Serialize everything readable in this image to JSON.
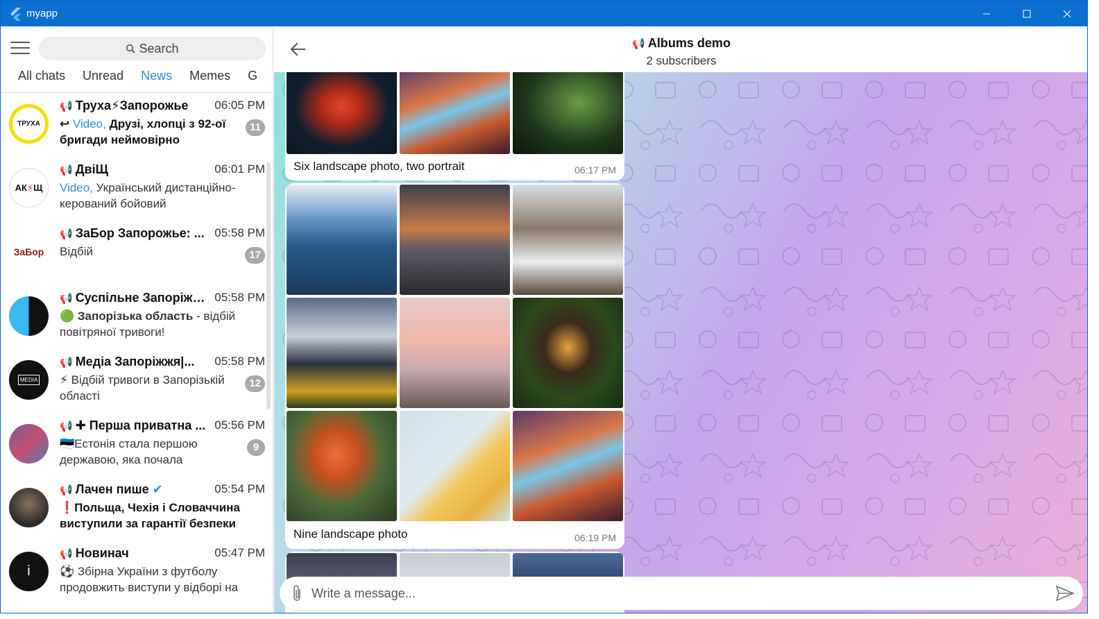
{
  "window": {
    "title": "myapp",
    "accent": "#0b6fd0"
  },
  "search": {
    "placeholder": "Search"
  },
  "tabs": [
    {
      "label": "All chats"
    },
    {
      "label": "Unread"
    },
    {
      "label": "News"
    },
    {
      "label": "Memes"
    },
    {
      "label": "G"
    }
  ],
  "chats": [
    {
      "name": "Труха⚡Запорожье",
      "time": "06:05 PM",
      "preview_prefix": "Video,",
      "preview": "Друзі, хлопці з 92-ої бригади неймовірно",
      "badge": "11"
    },
    {
      "name": "ДвіЩ",
      "time": "06:01 PM",
      "preview_prefix": "Video,",
      "preview": "Український дистанційно-керований бойовий",
      "badge": ""
    },
    {
      "name": "ЗаБор Запорожье: ...",
      "time": "05:58 PM",
      "preview_prefix": "",
      "preview": "Відбій",
      "badge": "17"
    },
    {
      "name": "Суспільне Запоріжж...",
      "time": "05:58 PM",
      "preview_prefix": "",
      "preview_bold": "Запорізька область",
      "preview": "- відбій повітряної тривоги!",
      "badge": ""
    },
    {
      "name": "Медіа Запоріжжя|...",
      "time": "05:58 PM",
      "preview_prefix": "",
      "preview": "Відбій тривоги в Запорізькій області",
      "badge": "12"
    },
    {
      "name": "Перша приватна ...",
      "time": "05:56 PM",
      "preview_prefix": "",
      "preview": "Естонія стала першою державою, яка почала",
      "badge": "9"
    },
    {
      "name": "Лачен пише",
      "time": "05:54 PM",
      "preview_prefix": "",
      "preview": "Польща, Чехія і Словаччина виступили за гарантії безпеки",
      "badge": ""
    },
    {
      "name": "Новинач",
      "time": "05:47 PM",
      "preview_prefix": "",
      "preview": "Збірна України з футболу продовжить виступи у відборі на",
      "badge": ""
    }
  ],
  "channel": {
    "title": "Albums demo",
    "subtitle": "2 subscribers"
  },
  "messages": [
    {
      "caption": "Six landscape photo, two portrait",
      "time": "06:17 PM"
    },
    {
      "caption": "Nine landscape photo",
      "time": "06:19 PM"
    }
  ],
  "composer": {
    "placeholder": "Write a message..."
  },
  "icons": {
    "menu": "hamburger-icon",
    "search": "search-icon",
    "back": "arrow-left-icon",
    "attach": "paperclip-icon",
    "send": "send-icon",
    "channel": "megaphone-icon",
    "verified": "verified-icon"
  }
}
